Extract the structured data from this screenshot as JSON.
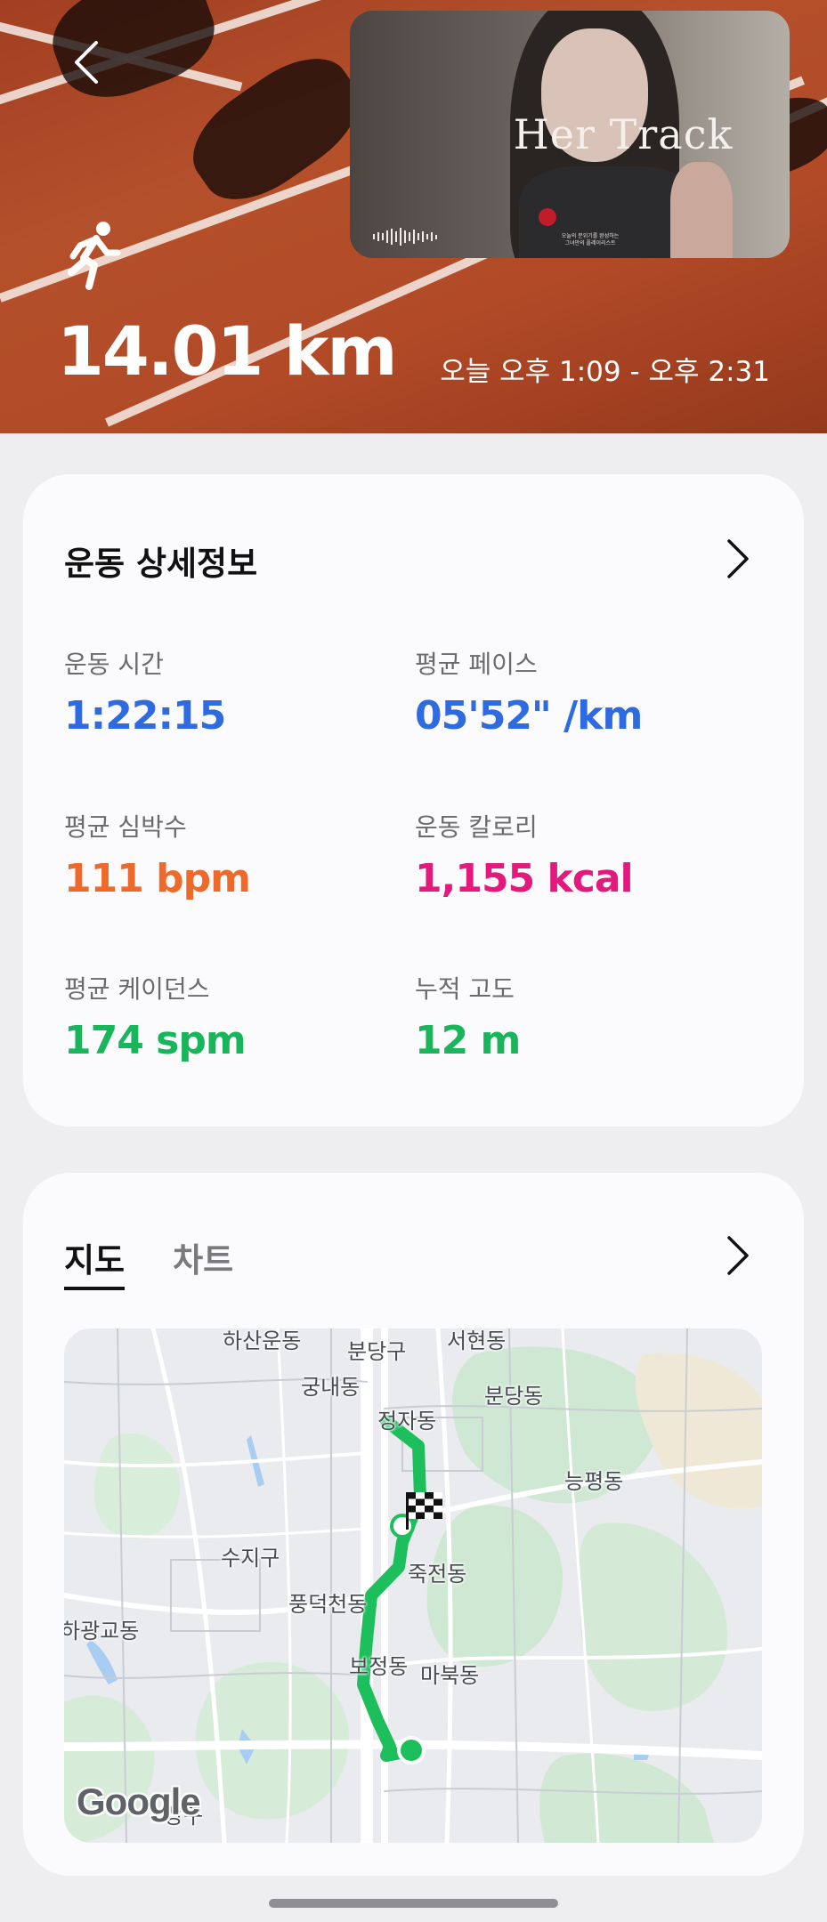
{
  "hero": {
    "distance": "14.01 km",
    "time_range": "오늘 오후 1:09 - 오후 2:31",
    "activity_icon": "running-person-icon",
    "back_icon": "chevron-left-icon"
  },
  "music": {
    "title": "Her Track",
    "caption_line1": "오늘의 분위기를 완성하는",
    "caption_line2": "그녀만의 플레이리스트"
  },
  "details": {
    "title": "운동 상세정보",
    "stats": [
      {
        "label": "운동 시간",
        "value": "1:22:15",
        "color": "#2f6be0"
      },
      {
        "label": "평균 페이스",
        "value": "05'52\" /km",
        "color": "#2f6be0"
      },
      {
        "label": "평균 심박수",
        "value": "111 bpm",
        "color": "#ee6a2b"
      },
      {
        "label": "운동 칼로리",
        "value": "1,155 kcal",
        "color": "#e3197d"
      },
      {
        "label": "평균 케이던스",
        "value": "174 spm",
        "color": "#18b55b"
      },
      {
        "label": "누적 고도",
        "value": "12 m",
        "color": "#18b55b"
      }
    ]
  },
  "map_section": {
    "tabs": [
      "지도",
      "차트"
    ],
    "active_tab": "지도",
    "map_labels": [
      "하산운동",
      "분당구",
      "서현동",
      "궁내동",
      "분당동",
      "정자동",
      "능평동",
      "수지구",
      "죽전동",
      "풍덕천동",
      "하광교동",
      "보정동",
      "마북동",
      "상구"
    ],
    "google": "Google",
    "route_color": "#1dbf5c"
  }
}
